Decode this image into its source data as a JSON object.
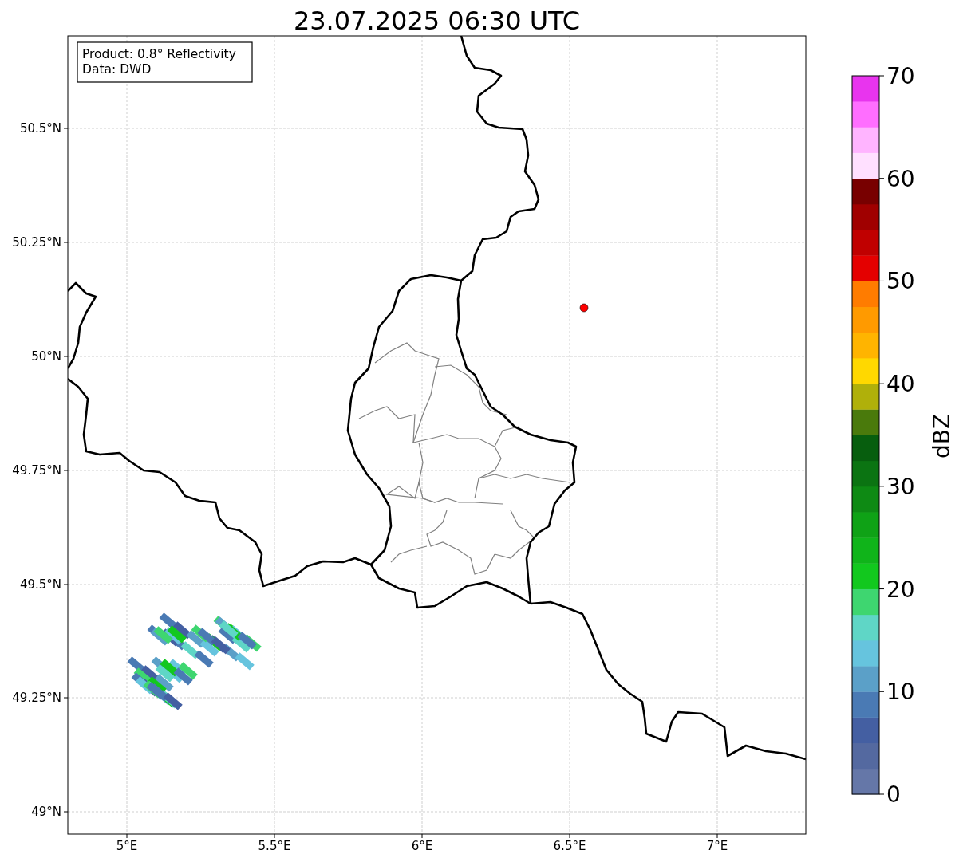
{
  "title": "23.07.2025 06:30 UTC",
  "info_box": {
    "lines": [
      "Product: 0.8° Reflectivity",
      "Data: DWD"
    ]
  },
  "x_axis": {
    "ticks": [
      "5°E",
      "5.5°E",
      "6°E",
      "6.5°E",
      "7°E"
    ]
  },
  "y_axis": {
    "ticks": [
      "50.5°N",
      "50.25°N",
      "50°N",
      "49.75°N",
      "49.5°N",
      "49.25°N",
      "49°N"
    ]
  },
  "colorbar": {
    "label": "dBZ",
    "ticks": [
      "70",
      "60",
      "50",
      "40",
      "30",
      "20",
      "10",
      "0"
    ],
    "bins": [
      {
        "color": "#6577a8"
      },
      {
        "color": "#5469a0"
      },
      {
        "color": "#445fa2"
      },
      {
        "color": "#4a7ab4"
      },
      {
        "color": "#5ba0c8"
      },
      {
        "color": "#66c4de"
      },
      {
        "color": "#5fd6c6"
      },
      {
        "color": "#3ed670"
      },
      {
        "color": "#12c81e"
      },
      {
        "color": "#10b41a"
      },
      {
        "color": "#0fa216"
      },
      {
        "color": "#0e8a14"
      },
      {
        "color": "#0b7412"
      },
      {
        "color": "#075e0e"
      },
      {
        "color": "#4a7a0c"
      },
      {
        "color": "#b0b00a"
      },
      {
        "color": "#ffd800"
      },
      {
        "color": "#ffb400"
      },
      {
        "color": "#ff9a00"
      },
      {
        "color": "#ff7c00"
      },
      {
        "color": "#e40000"
      },
      {
        "color": "#c00000"
      },
      {
        "color": "#a00000"
      },
      {
        "color": "#780000"
      },
      {
        "color": "#ffe0ff"
      },
      {
        "color": "#ffb4ff"
      },
      {
        "color": "#ff6eff"
      },
      {
        "color": "#e834ee"
      }
    ]
  }
}
